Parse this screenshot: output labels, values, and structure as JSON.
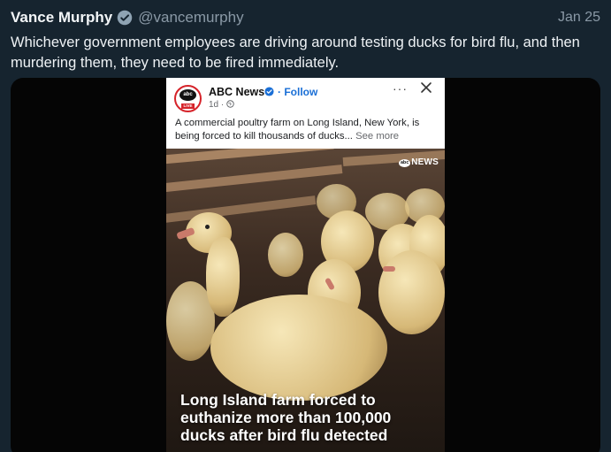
{
  "tweet": {
    "author_name": "Vance Murphy",
    "handle": "@vancemurphy",
    "date": "Jan 25",
    "text": "Whichever government employees are driving around testing ducks for bird flu, and then murdering them, they need to be fired immediately."
  },
  "embedded_post": {
    "page_name": "ABC News",
    "follow_label": "Follow",
    "time": "1d ·",
    "more_label": "···",
    "caption": "A commercial poultry farm on Long Island, New York, is being forced to kill thousands of ducks...",
    "see_more": "See more",
    "avatar_text": "abc",
    "avatar_live": "LIVE",
    "photo_logo": "NEWS",
    "photo_logo_mark": "abc",
    "headline": "Long Island farm forced to euthanize more than 100,000 ducks after bird flu detected"
  },
  "colors": {
    "background": "#16242f",
    "verified_badge": "#8fa3b3",
    "fb_link": "#1a6fd6"
  }
}
